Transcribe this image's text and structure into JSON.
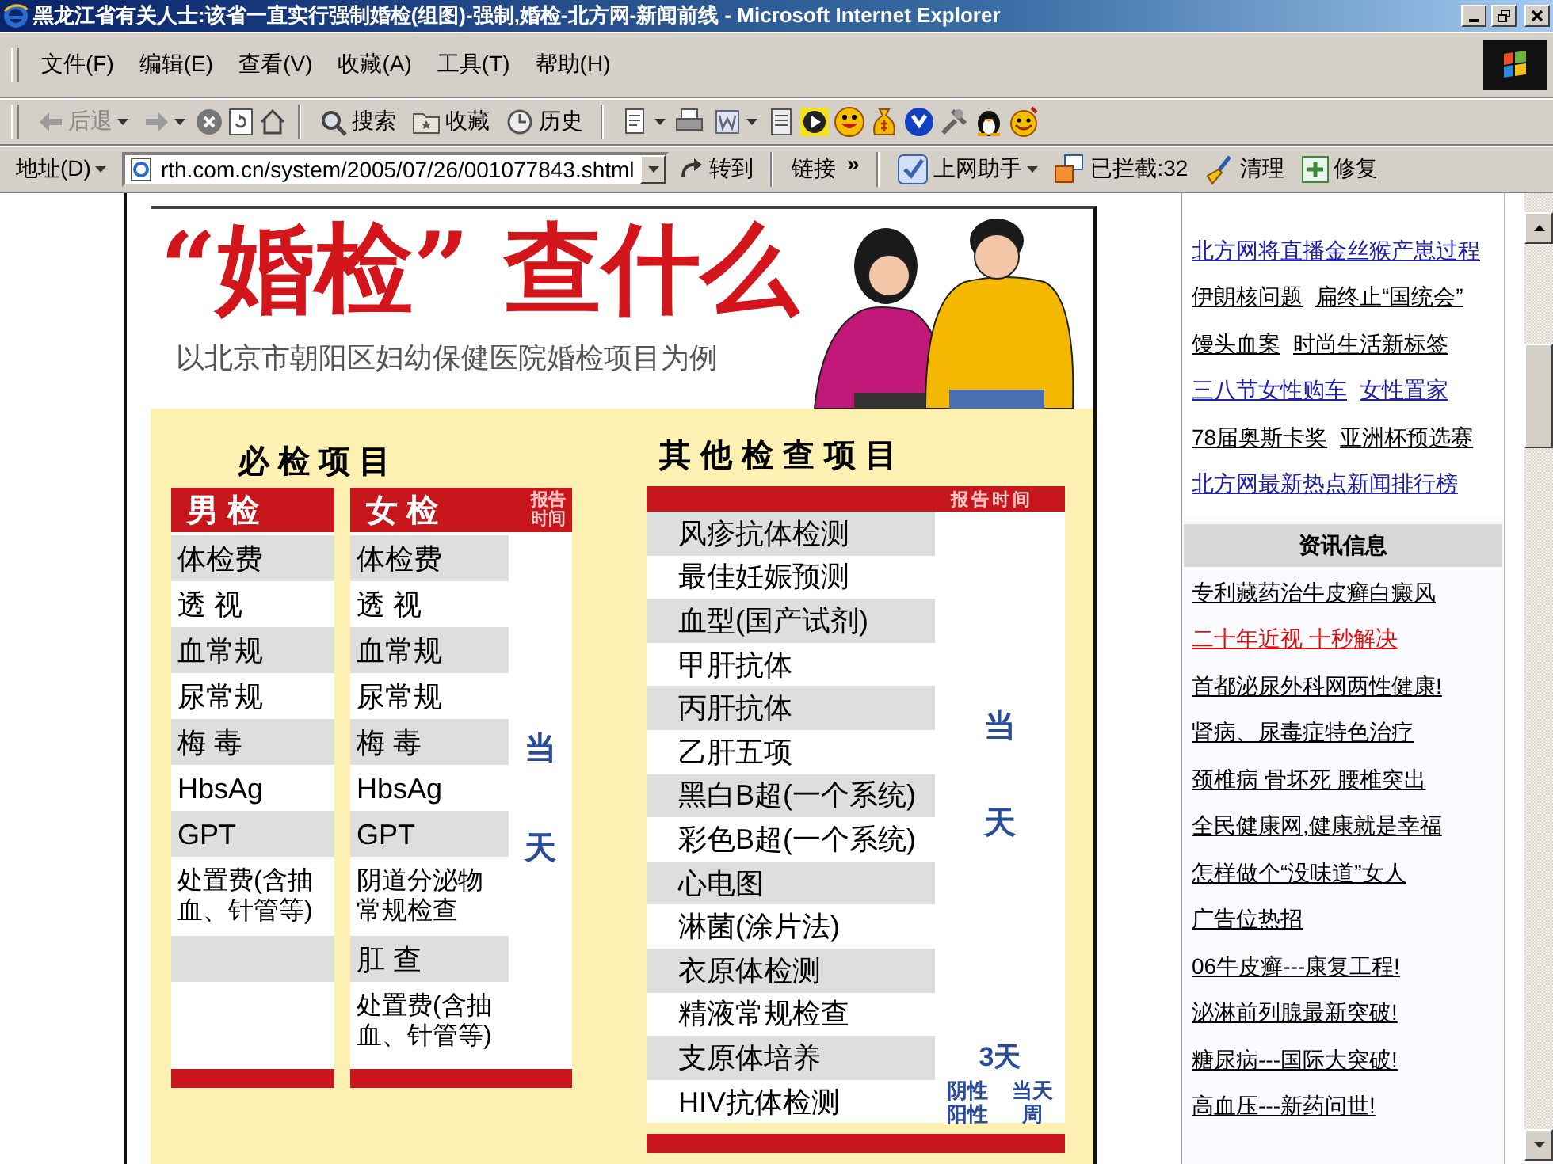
{
  "window": {
    "title": "黑龙江省有关人士:该省一直实行强制婚检(组图)-强制,婚检-北方网-新闻前线 - Microsoft Internet Explorer"
  },
  "menu": [
    {
      "label": "文件(F)"
    },
    {
      "label": "编辑(E)"
    },
    {
      "label": "查看(V)"
    },
    {
      "label": "收藏(A)"
    },
    {
      "label": "工具(T)"
    },
    {
      "label": "帮助(H)"
    }
  ],
  "toolbar": {
    "back": {
      "label": "后退",
      "disabled": true
    },
    "forward": {
      "disabled": true
    },
    "search": "搜索",
    "favorites": "收藏",
    "history": "历史"
  },
  "address_bar": {
    "label": "地址(D)",
    "url": "rth.com.cn/system/2005/07/26/001077843.shtml",
    "go": "转到",
    "links": "链接",
    "more": "»"
  },
  "helper_bar": {
    "assistant": "上网助手",
    "blocked": "已拦截:32",
    "clean": "清理",
    "repair": "修复"
  },
  "article_image": {
    "title": "“婚检” 查什么",
    "subtitle": "以北京市朝阳区妇幼保健医院婚检项目为例",
    "required": {
      "heading": "必 检 项 目",
      "male_header": "男 检",
      "female_header": "女 检",
      "time_header": "报告时间",
      "male_items": [
        "体检费",
        "透 视",
        "血常规",
        "尿常规",
        "梅 毒",
        "HbsAg",
        "GPT",
        "处置费(含抽血、针管等)"
      ],
      "female_items": [
        "体检费",
        "透 视",
        "血常规",
        "尿常规",
        "梅 毒",
        "HbsAg",
        "GPT",
        "阴道分泌物常规检查",
        "肛 查",
        "处置费(含抽血、针管等)"
      ],
      "time_marks": [
        "当",
        "天"
      ]
    },
    "other": {
      "heading": "其他检查项目",
      "time_header": "报告时间",
      "time_marks": [
        "当",
        "天"
      ],
      "items": [
        {
          "name": "风疹抗体检测"
        },
        {
          "name": "最佳妊娠预测"
        },
        {
          "name": "血型(国产试剂)"
        },
        {
          "name": "甲肝抗体"
        },
        {
          "name": "丙肝抗体"
        },
        {
          "name": "乙肝五项"
        },
        {
          "name": "黑白B超(一个系统)"
        },
        {
          "name": "彩色B超(一个系统)"
        },
        {
          "name": "心电图"
        },
        {
          "name": "淋菌(涂片法)"
        },
        {
          "name": "衣原体检测"
        },
        {
          "name": "精液常规检查"
        },
        {
          "name": "支原体培养",
          "time": "3天"
        },
        {
          "name": "HIV抗体检测",
          "results": [
            "阴性",
            "阳性"
          ],
          "times": [
            "当天",
            "周"
          ]
        }
      ]
    }
  },
  "sidebar": {
    "rows": [
      {
        "links": [
          {
            "text": "北方网将直播金丝猴产崽过程",
            "color": "#2020a8"
          }
        ]
      },
      {
        "links": [
          {
            "text": "伊朗核问题",
            "color": "#000000"
          },
          {
            "text": "扁终止“国统会”",
            "color": "#000000"
          }
        ]
      },
      {
        "links": [
          {
            "text": "馒头血案",
            "color": "#000000"
          },
          {
            "text": "时尚生活新标签",
            "color": "#000000"
          }
        ]
      },
      {
        "links": [
          {
            "text": "三八节女性购车",
            "color": "#2020a8"
          },
          {
            "text": "女性置家",
            "color": "#2020a8"
          }
        ]
      },
      {
        "links": [
          {
            "text": "78届奥斯卡奖",
            "color": "#000000"
          },
          {
            "text": "亚洲杯预选赛",
            "color": "#000000"
          }
        ]
      },
      {
        "links": [
          {
            "text": "北方网最新热点新闻排行榜",
            "color": "#2020a8"
          }
        ]
      }
    ],
    "section_title": "资讯信息",
    "info_links": [
      {
        "text": "专利藏药治牛皮癣白癜风",
        "color": "#000000"
      },
      {
        "text": "二十年近视 十秒解决",
        "color": "#e01010"
      },
      {
        "text": "首都泌尿外科网两性健康!",
        "color": "#000000"
      },
      {
        "text": "肾病、尿毒症特色治疗",
        "color": "#000000"
      },
      {
        "text": "颈椎病 骨坏死 腰椎突出",
        "color": "#000000"
      },
      {
        "text": "全民健康网,健康就是幸福",
        "color": "#000000"
      },
      {
        "text": "怎样做个“没味道”女人",
        "color": "#000000"
      },
      {
        "text": "广告位热招",
        "color": "#000000"
      },
      {
        "text": "06牛皮癣---康复工程!",
        "color": "#000000"
      },
      {
        "text": "泌淋前列腺最新突破!",
        "color": "#000000"
      },
      {
        "text": "糖尿病---国际大突破!",
        "color": "#000000"
      },
      {
        "text": "高血压---新药问世!",
        "color": "#000000"
      }
    ]
  }
}
